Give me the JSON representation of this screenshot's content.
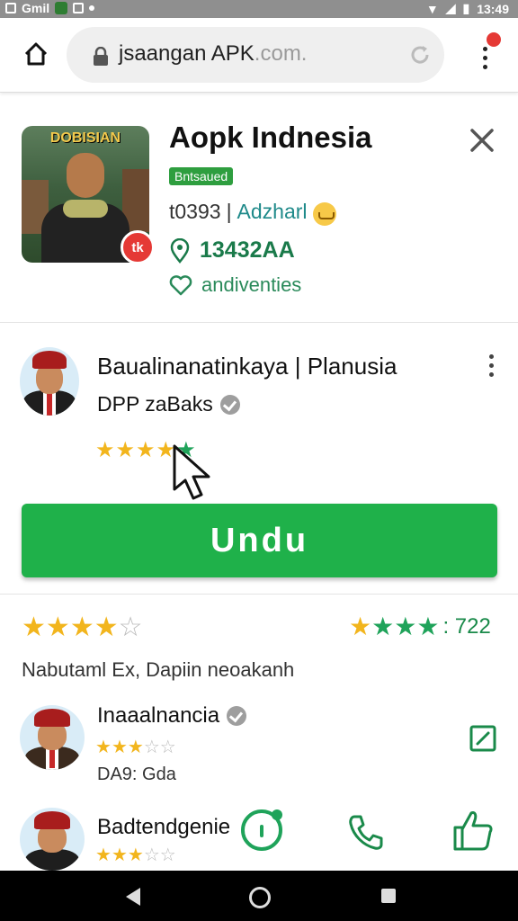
{
  "status_bar": {
    "left_text": "Gmil",
    "time": "13:49"
  },
  "browser": {
    "url_main": "jsaangan APK",
    "url_suffix": ".com.",
    "icons": [
      "home-icon",
      "lock-icon",
      "reload-icon",
      "menu-icon"
    ]
  },
  "app": {
    "icon_title": "DOBISIAN",
    "icon_badge": "tk",
    "title": "Aopk Indnesia",
    "tag": "Bntsaued",
    "dev_left": "t0393",
    "dev_name": "Adzharl",
    "downloads": "13432AA",
    "likes_label": "andiventies"
  },
  "developer": {
    "name": "Baualinanatinkaya | Planusia",
    "subtitle": "DPP zaBaks",
    "stars": {
      "filled": 4,
      "total": 5
    }
  },
  "download_button": {
    "label": "Undu"
  },
  "ratings": {
    "stars_left": {
      "filled": 4,
      "total": 5
    },
    "stars_right": {
      "filled": 4,
      "total": 4
    },
    "count": ": 722",
    "heading": "Nabutaml Ex, Dapiin neoakanh"
  },
  "reviews": [
    {
      "name": "Inaaalnancia",
      "stars_filled": 3,
      "stars_total": 5,
      "date": "DA9: Gda"
    },
    {
      "name": "Badtendgenie",
      "stars_filled": 3,
      "stars_total": 5
    }
  ],
  "colors": {
    "accent_green": "#1fb14a",
    "status_bar": "#8f8f8f",
    "badge_red": "#e53935",
    "star_yellow": "#f2b51d"
  }
}
